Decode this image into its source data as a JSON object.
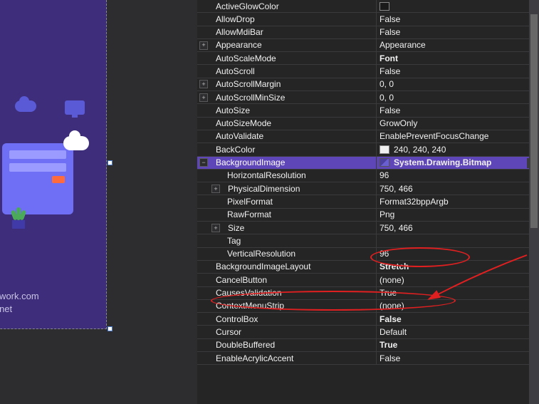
{
  "designer": {
    "url1": "mework.com",
    "url2": "de.net"
  },
  "properties": [
    {
      "name": "ActiveGlowColor",
      "value": "",
      "indent": 0,
      "exp": null,
      "swatch": "#1a1a1a",
      "bold": false
    },
    {
      "name": "AllowDrop",
      "value": "False",
      "indent": 0,
      "exp": null,
      "bold": false
    },
    {
      "name": "AllowMdiBar",
      "value": "False",
      "indent": 0,
      "exp": null,
      "bold": false
    },
    {
      "name": "Appearance",
      "value": "Appearance",
      "indent": 0,
      "exp": "plus",
      "bold": false
    },
    {
      "name": "AutoScaleMode",
      "value": "Font",
      "indent": 0,
      "exp": null,
      "bold": true
    },
    {
      "name": "AutoScroll",
      "value": "False",
      "indent": 0,
      "exp": null,
      "bold": false
    },
    {
      "name": "AutoScrollMargin",
      "value": "0, 0",
      "indent": 0,
      "exp": "plus",
      "bold": false
    },
    {
      "name": "AutoScrollMinSize",
      "value": "0, 0",
      "indent": 0,
      "exp": "plus",
      "bold": false
    },
    {
      "name": "AutoSize",
      "value": "False",
      "indent": 0,
      "exp": null,
      "bold": false
    },
    {
      "name": "AutoSizeMode",
      "value": "GrowOnly",
      "indent": 0,
      "exp": null,
      "bold": false
    },
    {
      "name": "AutoValidate",
      "value": "EnablePreventFocusChange",
      "indent": 0,
      "exp": null,
      "bold": false
    },
    {
      "name": "BackColor",
      "value": "240, 240, 240",
      "indent": 0,
      "exp": null,
      "swatch": "#f0f0f0",
      "bold": false
    },
    {
      "name": "BackgroundImage",
      "value": "System.Drawing.Bitmap",
      "indent": 0,
      "exp": "minus",
      "bold": true,
      "selected": true,
      "thumb": true,
      "dd": true
    },
    {
      "name": "HorizontalResolution",
      "value": "96",
      "indent": 1,
      "exp": null,
      "bold": false
    },
    {
      "name": "PhysicalDimension",
      "value": "750, 466",
      "indent": 1,
      "exp": "plus",
      "bold": false
    },
    {
      "name": "PixelFormat",
      "value": "Format32bppArgb",
      "indent": 1,
      "exp": null,
      "bold": false
    },
    {
      "name": "RawFormat",
      "value": "Png",
      "indent": 1,
      "exp": null,
      "bold": false
    },
    {
      "name": "Size",
      "value": "750, 466",
      "indent": 1,
      "exp": "plus",
      "bold": false
    },
    {
      "name": "Tag",
      "value": "",
      "indent": 1,
      "exp": null,
      "bold": false
    },
    {
      "name": "VerticalResolution",
      "value": "96",
      "indent": 1,
      "exp": null,
      "bold": false
    },
    {
      "name": "BackgroundImageLayout",
      "value": "Stretch",
      "indent": 0,
      "exp": null,
      "bold": true
    },
    {
      "name": "CancelButton",
      "value": "(none)",
      "indent": 0,
      "exp": null,
      "bold": false
    },
    {
      "name": "CausesValidation",
      "value": "True",
      "indent": 0,
      "exp": null,
      "bold": false
    },
    {
      "name": "ContextMenuStrip",
      "value": "(none)",
      "indent": 0,
      "exp": null,
      "bold": false
    },
    {
      "name": "ControlBox",
      "value": "False",
      "indent": 0,
      "exp": null,
      "bold": true
    },
    {
      "name": "Cursor",
      "value": "Default",
      "indent": 0,
      "exp": null,
      "bold": false
    },
    {
      "name": "DoubleBuffered",
      "value": "True",
      "indent": 0,
      "exp": null,
      "bold": true
    },
    {
      "name": "EnableAcrylicAccent",
      "value": "False",
      "indent": 0,
      "exp": null,
      "bold": false
    }
  ],
  "expand_glyph": {
    "plus": "+",
    "minus": "−"
  },
  "dropdown_glyph": "▾"
}
